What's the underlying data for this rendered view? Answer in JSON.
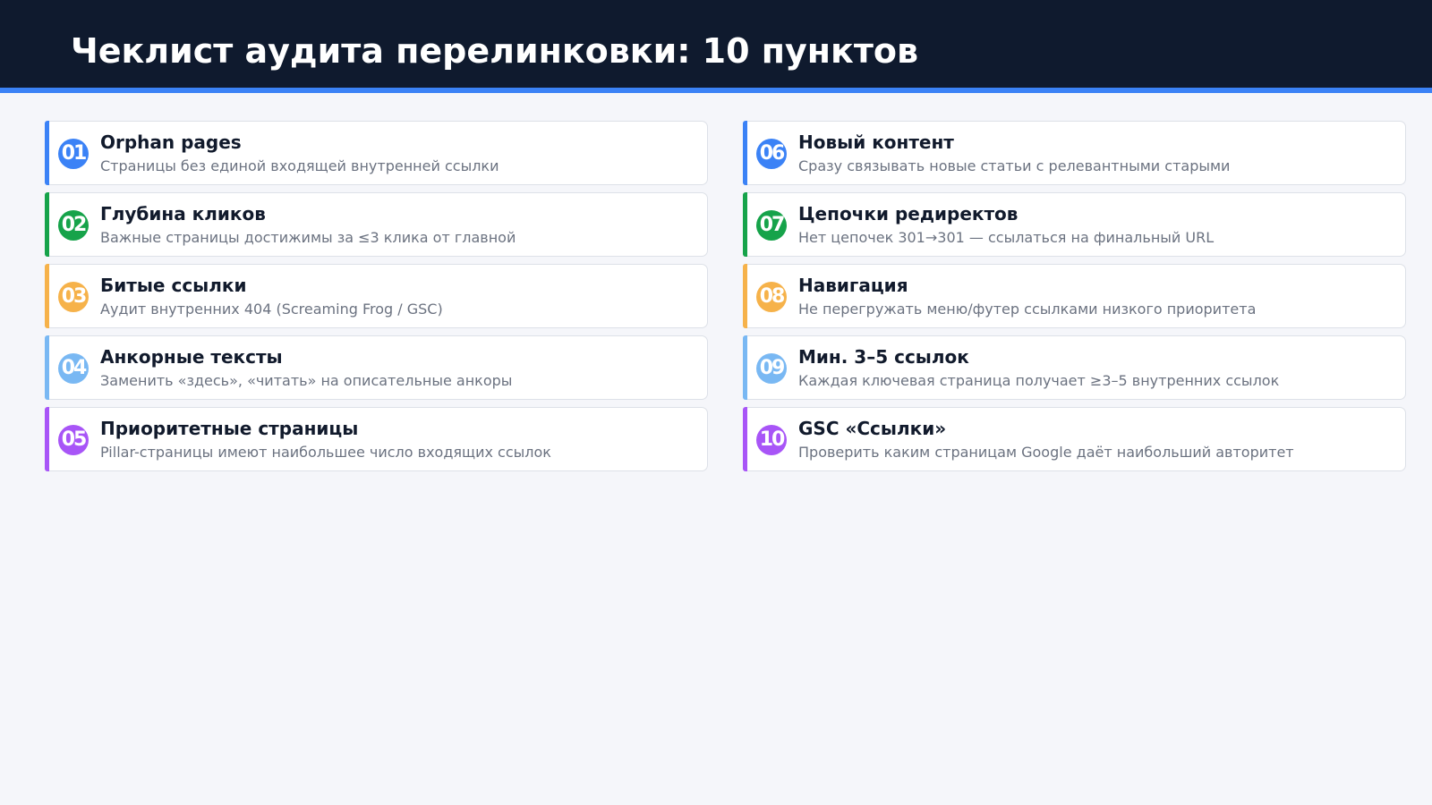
{
  "header": {
    "title": "Чеклист аудита перелинковки: 10 пунктов"
  },
  "colors": {
    "header_bg": "#0f1a2e",
    "header_accent": "#3b82f6",
    "background": "#f5f6fa",
    "blue": "#3b82f6",
    "green": "#16a34a",
    "orange": "#f6b24a",
    "light_blue": "#79b8f3",
    "purple": "#a855f7"
  },
  "items": [
    {
      "num": "01",
      "title": "Orphan pages",
      "desc": "Страницы без единой входящей внутренней ссылки",
      "color": "#3b82f6"
    },
    {
      "num": "02",
      "title": "Глубина кликов",
      "desc": "Важные страницы достижимы за ≤3 клика от главной",
      "color": "#16a34a"
    },
    {
      "num": "03",
      "title": "Битые ссылки",
      "desc": "Аудит внутренних 404 (Screaming Frog / GSC)",
      "color": "#f6b24a"
    },
    {
      "num": "04",
      "title": "Анкорные тексты",
      "desc": "Заменить «здесь», «читать» на описательные анкоры",
      "color": "#79b8f3"
    },
    {
      "num": "05",
      "title": "Приоритетные страницы",
      "desc": "Pillar-страницы имеют наибольшее число входящих ссылок",
      "color": "#a855f7"
    },
    {
      "num": "06",
      "title": "Новый контент",
      "desc": "Сразу связывать новые статьи с релевантными старыми",
      "color": "#3b82f6"
    },
    {
      "num": "07",
      "title": "Цепочки редиректов",
      "desc": "Нет цепочек 301→301 — ссылаться на финальный URL",
      "color": "#16a34a"
    },
    {
      "num": "08",
      "title": "Навигация",
      "desc": "Не перегружать меню/футер ссылками низкого приоритета",
      "color": "#f6b24a"
    },
    {
      "num": "09",
      "title": "Мин. 3–5 ссылок",
      "desc": "Каждая ключевая страница получает ≥3–5 внутренних ссылок",
      "color": "#79b8f3"
    },
    {
      "num": "10",
      "title": "GSC «Ссылки»",
      "desc": "Проверить каким страницам Google даёт наибольший авторитет",
      "color": "#a855f7"
    }
  ]
}
